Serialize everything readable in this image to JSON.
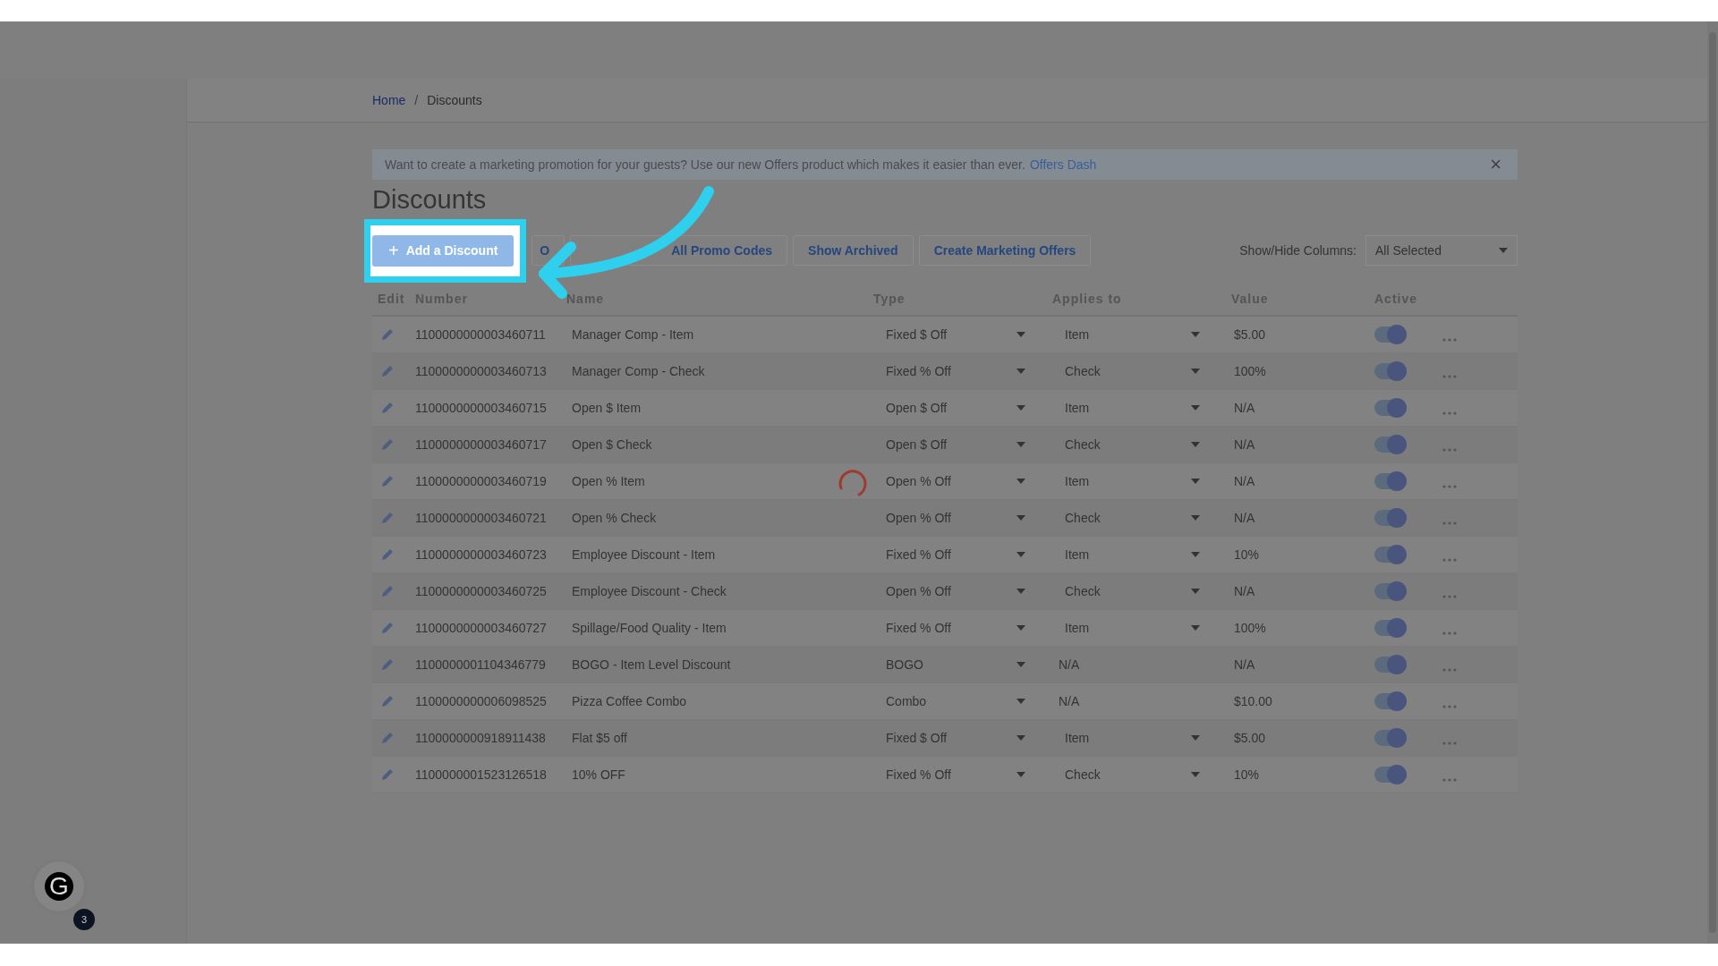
{
  "breadcrumbs": [
    {
      "label": "Home",
      "kind": "link"
    },
    {
      "label": "/",
      "kind": "separator"
    },
    {
      "label": "Discounts",
      "kind": "current"
    }
  ],
  "banner": {
    "text": "Want to create a marketing promotion for your guests? Use our new Offers product which makes it easier than ever.",
    "link": "Offers Dash",
    "close": "×"
  },
  "title": "Discounts",
  "toolbar": {
    "primary": {
      "icon": "+",
      "label": "Add a Discount"
    },
    "buttons": [
      "O",
      "All Promo Codes",
      "Show Archived",
      "Create Marketing Offers"
    ],
    "columns_label": "Show/Hide Columns:",
    "columns_value": "All Selected"
  },
  "table": {
    "columns": [
      "Edit",
      "Number",
      "Name",
      "Type",
      "Applies to",
      "Value",
      "Active"
    ],
    "rows": [
      {
        "number": "1100000000003460711",
        "name": "Manager Comp - Item",
        "type": "Fixed $ Off",
        "applies_to": "Item",
        "applies_editable": true,
        "value": "$5.00",
        "active": true
      },
      {
        "number": "1100000000003460713",
        "name": "Manager Comp - Check",
        "type": "Fixed % Off",
        "applies_to": "Check",
        "applies_editable": true,
        "value": "100%",
        "active": true
      },
      {
        "number": "1100000000003460715",
        "name": "Open $ Item",
        "type": "Open $ Off",
        "applies_to": "Item",
        "applies_editable": true,
        "value": "N/A",
        "active": true
      },
      {
        "number": "1100000000003460717",
        "name": "Open $ Check",
        "type": "Open $ Off",
        "applies_to": "Check",
        "applies_editable": true,
        "value": "N/A",
        "active": true
      },
      {
        "number": "1100000000003460719",
        "name": "Open % Item",
        "type": "Open % Off",
        "applies_to": "Item",
        "applies_editable": true,
        "value": "N/A",
        "active": true
      },
      {
        "number": "1100000000003460721",
        "name": "Open % Check",
        "type": "Open % Off",
        "applies_to": "Check",
        "applies_editable": true,
        "value": "N/A",
        "active": true
      },
      {
        "number": "1100000000003460723",
        "name": "Employee Discount - Item",
        "type": "Fixed % Off",
        "applies_to": "Item",
        "applies_editable": true,
        "value": "10%",
        "active": true
      },
      {
        "number": "1100000000003460725",
        "name": "Employee Discount - Check",
        "type": "Open % Off",
        "applies_to": "Check",
        "applies_editable": true,
        "value": "N/A",
        "active": true
      },
      {
        "number": "1100000000003460727",
        "name": "Spillage/Food Quality - Item",
        "type": "Fixed % Off",
        "applies_to": "Item",
        "applies_editable": true,
        "value": "100%",
        "active": true
      },
      {
        "number": "1100000001104346779",
        "name": "BOGO - Item Level Discount",
        "type": "BOGO",
        "applies_to": "N/A",
        "applies_editable": false,
        "value": "N/A",
        "active": true
      },
      {
        "number": "1100000000006098525",
        "name": "Pizza Coffee Combo",
        "type": "Combo",
        "applies_to": "N/A",
        "applies_editable": false,
        "value": "$10.00",
        "active": true
      },
      {
        "number": "1100000000918911438",
        "name": "Flat $5 off",
        "type": "Fixed $ Off",
        "applies_to": "Item",
        "applies_editable": true,
        "value": "$5.00",
        "active": true
      },
      {
        "number": "1100000001523126518",
        "name": "10% OFF",
        "type": "Fixed % Off",
        "applies_to": "Check",
        "applies_editable": true,
        "value": "10%",
        "active": true
      }
    ]
  },
  "launcher": {
    "letter": "G",
    "badge": "3"
  }
}
